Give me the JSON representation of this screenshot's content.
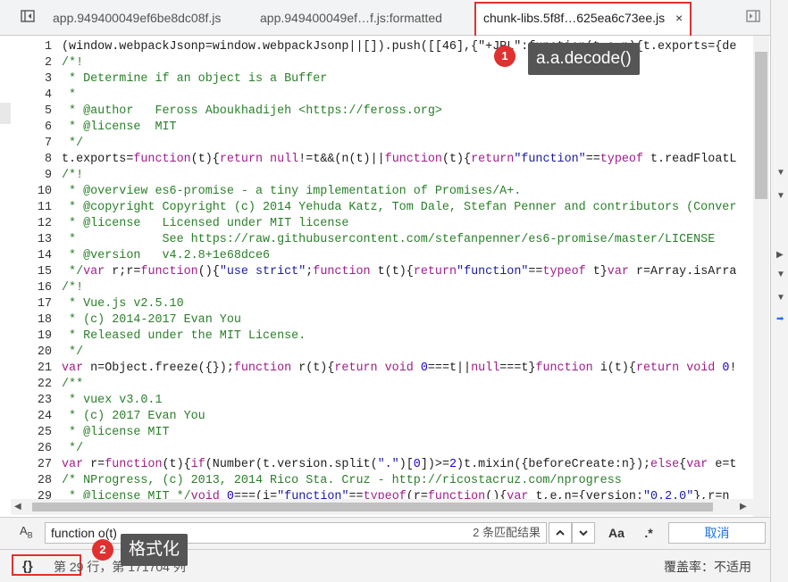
{
  "tabs": [
    {
      "label": "app.949400049ef6be8dc08f.js",
      "active": false
    },
    {
      "label": "app.949400049ef…f.js:formatted",
      "active": false
    },
    {
      "label": "chunk-libs.5f8f…625ea6c73ee.js",
      "active": true
    }
  ],
  "tab_close": "×",
  "annotations": [
    {
      "badge": "1",
      "tooltip": "a.a.decode()"
    },
    {
      "badge": "2",
      "tooltip": "格式化"
    }
  ],
  "code_lines": [
    {
      "n": "1",
      "html": "(window.webpackJsonp=window.webpackJsonp||[]).push([[46],{\"+JPL\":function(t,e,n){t.exports={de"
    },
    {
      "n": "2",
      "html": "<span class='cm'>/*!</span>"
    },
    {
      "n": "3",
      "html": "<span class='cm'> * Determine if an object is a Buffer</span>"
    },
    {
      "n": "4",
      "html": "<span class='cm'> *</span>"
    },
    {
      "n": "5",
      "html": "<span class='cm'> * @author   Feross Aboukhadijeh &lt;https://feross.org&gt;</span>"
    },
    {
      "n": "6",
      "html": "<span class='cm'> * @license  MIT</span>"
    },
    {
      "n": "7",
      "html": "<span class='cm'> */</span>"
    },
    {
      "n": "8",
      "html": "t.exports=<span class='kw'>function</span>(t){<span class='kw'>return null</span>!=t&amp;&amp;(n(t)||<span class='kw'>function</span>(t){<span class='kw'>return</span><span class='str'>\"function\"</span>==<span class='kw'>typeof</span> t.readFloatL"
    },
    {
      "n": "9",
      "html": "<span class='cm'>/*!</span>"
    },
    {
      "n": "10",
      "html": "<span class='cm'> * @overview es6-promise - a tiny implementation of Promises/A+.</span>"
    },
    {
      "n": "11",
      "html": "<span class='cm'> * @copyright Copyright (c) 2014 Yehuda Katz, Tom Dale, Stefan Penner and contributors (Conver</span>"
    },
    {
      "n": "12",
      "html": "<span class='cm'> * @license   Licensed under MIT license</span>"
    },
    {
      "n": "13",
      "html": "<span class='cm'> *            See https://raw.githubusercontent.com/stefanpenner/es6-promise/master/LICENSE</span>"
    },
    {
      "n": "14",
      "html": "<span class='cm'> * @version   v4.2.8+1e68dce6</span>"
    },
    {
      "n": "15",
      "html": "<span class='cm'> */</span><span class='kw'>var</span> r;r=<span class='kw'>function</span>(){<span class='str'>\"use strict\"</span>;<span class='kw'>function</span> t(t){<span class='kw'>return</span><span class='str'>\"function\"</span>==<span class='kw'>typeof</span> t}<span class='kw'>var</span> r=Array.isArra"
    },
    {
      "n": "16",
      "html": "<span class='cm'>/*!</span>"
    },
    {
      "n": "17",
      "html": "<span class='cm'> * Vue.js v2.5.10</span>"
    },
    {
      "n": "18",
      "html": "<span class='cm'> * (c) 2014-2017 Evan You</span>"
    },
    {
      "n": "19",
      "html": "<span class='cm'> * Released under the MIT License.</span>"
    },
    {
      "n": "20",
      "html": "<span class='cm'> */</span>"
    },
    {
      "n": "21",
      "html": "<span class='kw'>var</span> n=Object.freeze({});<span class='kw'>function</span> r(t){<span class='kw'>return void</span> <span class='num'>0</span>===t||<span class='kw'>null</span>===t}<span class='kw'>function</span> i(t){<span class='kw'>return void</span> <span class='num'>0</span>!"
    },
    {
      "n": "22",
      "html": "<span class='cm'>/**</span>"
    },
    {
      "n": "23",
      "html": "<span class='cm'> * vuex v3.0.1</span>"
    },
    {
      "n": "24",
      "html": "<span class='cm'> * (c) 2017 Evan You</span>"
    },
    {
      "n": "25",
      "html": "<span class='cm'> * @license MIT</span>"
    },
    {
      "n": "26",
      "html": "<span class='cm'> */</span>"
    },
    {
      "n": "27",
      "html": "<span class='kw'>var</span> r=<span class='kw'>function</span>(t){<span class='kw'>if</span>(Number(t.version.split(<span class='str'>\".\"</span>)[<span class='num'>0</span>])&gt;=<span class='num'>2</span>)t.mixin({beforeCreate:n});<span class='kw'>else</span>{<span class='kw'>var</span> e=t"
    },
    {
      "n": "28",
      "html": "<span class='cm'>/* NProgress, (c) 2013, 2014 Rico Sta. Cruz - http://ricostacruz.com/nprogress</span>"
    },
    {
      "n": "29",
      "html": "<span class='cm'> * @license MIT */</span><span class='kw'>void</span> <span class='num'>0</span>===(i=<span class='str'>\"function\"</span>==<span class='kw'>typeof</span>(r=<span class='kw'>function</span>(){<span class='kw'>var</span> t,e,n={version:<span class='str'>\"0.2.0\"</span>},r=n"
    }
  ],
  "search": {
    "value": "function o(t)",
    "match_count": "2 条匹配结果",
    "case_label": "Aa",
    "regex_label": ".*",
    "cancel_label": "取消"
  },
  "status": {
    "pretty_print_label": "{}",
    "position": "第 29 行，第 171704 列",
    "coverage": "覆盖率：不适用"
  }
}
